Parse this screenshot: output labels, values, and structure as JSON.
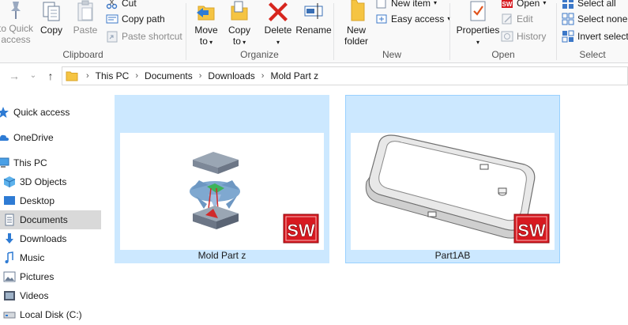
{
  "ribbon": {
    "pin": {
      "label_line1": "to Quick",
      "label_line2": "access"
    },
    "clipboard": {
      "group_label": "Clipboard",
      "copy": "Copy",
      "paste": "Paste",
      "cut": "Cut",
      "copy_path": "Copy path",
      "paste_shortcut": "Paste shortcut"
    },
    "organize": {
      "group_label": "Organize",
      "move_to": "Move",
      "move_to_2": "to",
      "copy_to": "Copy",
      "copy_to_2": "to",
      "delete": "Delete",
      "rename": "Rename"
    },
    "new": {
      "group_label": "New",
      "new_folder_1": "New",
      "new_folder_2": "folder",
      "new_item": "New item",
      "easy_access": "Easy access"
    },
    "open": {
      "group_label": "Open",
      "properties": "Properties",
      "open": "Open",
      "edit": "Edit",
      "history": "History"
    },
    "select": {
      "group_label": "Select",
      "select_all": "Select all",
      "select_none": "Select none",
      "invert_selection": "Invert selecti"
    }
  },
  "address": {
    "crumbs": [
      "This PC",
      "Documents",
      "Downloads",
      "Mold Part z"
    ]
  },
  "nav": {
    "items": [
      {
        "label": "Quick access",
        "icon": "star-icon"
      },
      {
        "label": "OneDrive",
        "icon": "cloud-icon"
      },
      {
        "label": "This PC",
        "icon": "computer-icon"
      },
      {
        "label": "3D Objects",
        "icon": "cube-icon"
      },
      {
        "label": "Desktop",
        "icon": "desktop-icon"
      },
      {
        "label": "Documents",
        "icon": "document-icon"
      },
      {
        "label": "Downloads",
        "icon": "download-icon"
      },
      {
        "label": "Music",
        "icon": "music-icon"
      },
      {
        "label": "Pictures",
        "icon": "pictures-icon"
      },
      {
        "label": "Videos",
        "icon": "video-icon"
      },
      {
        "label": "Local Disk (C:)",
        "icon": "disk-icon"
      }
    ]
  },
  "files": [
    {
      "name": "Mold Part z",
      "badge": "SW"
    },
    {
      "name": "Part1AB",
      "badge": "SW"
    }
  ],
  "colors": {
    "selection": "#cce8ff",
    "selection_border": "#99d1ff",
    "sw_red": "#d71920",
    "folder_yellow": "#f5c442"
  }
}
